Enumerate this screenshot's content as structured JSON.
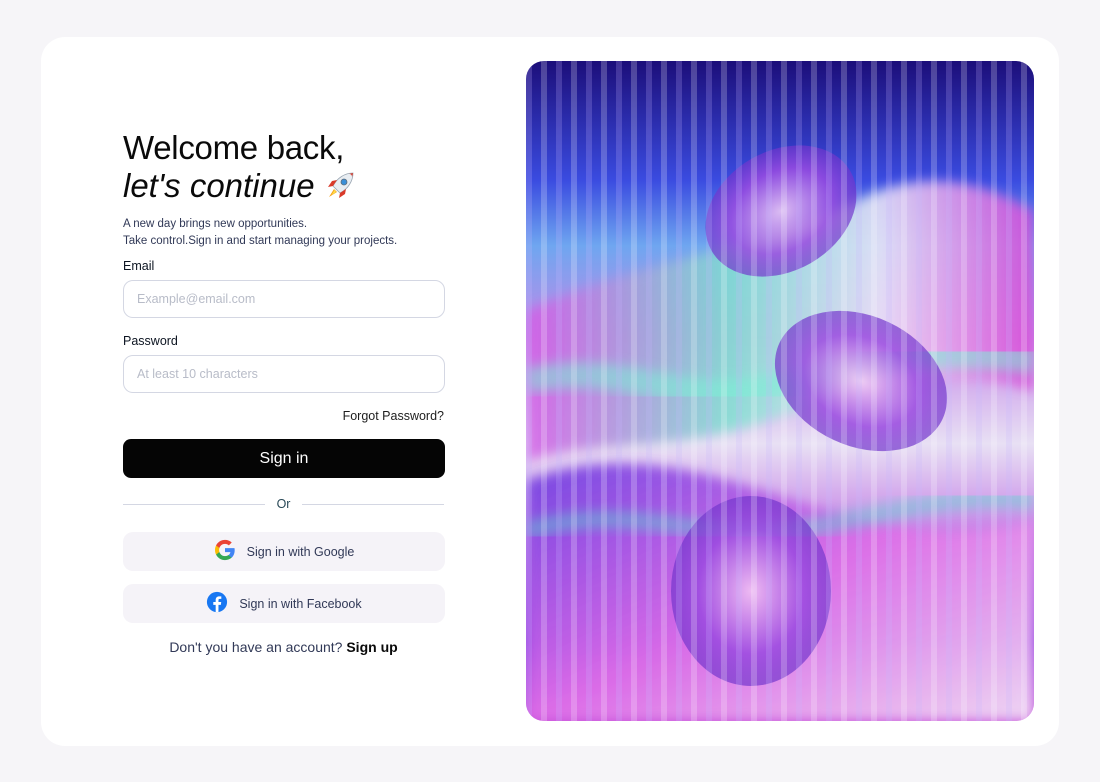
{
  "header": {
    "title_line1": "Welcome back,",
    "title_line2": "let's continue",
    "rocket_icon": "rocket-emoji-icon",
    "subtitle_line1": "A new day brings new opportunities.",
    "subtitle_line2": "Take control.Sign in and start managing your projects."
  },
  "form": {
    "email_label": "Email",
    "email_placeholder": "Example@email.com",
    "password_label": "Password",
    "password_placeholder": "At least 10 characters",
    "forgot_link": "Forgot Password?",
    "signin_label": "Sign in",
    "divider_text": "Or"
  },
  "social": {
    "google_label": "Sign in with Google",
    "google_icon": "google-icon",
    "facebook_label": "Sign in with Facebook",
    "facebook_icon": "facebook-icon"
  },
  "footer": {
    "prompt": "Don't you have an account?",
    "signup_link": "Sign up"
  },
  "art": {
    "description_icon": "holographic-faces-artwork"
  },
  "colors": {
    "page_bg": "#f6f5f8",
    "primary_button": "#050505",
    "social_button_bg": "#f5f3f8",
    "facebook_blue": "#1877f2"
  }
}
